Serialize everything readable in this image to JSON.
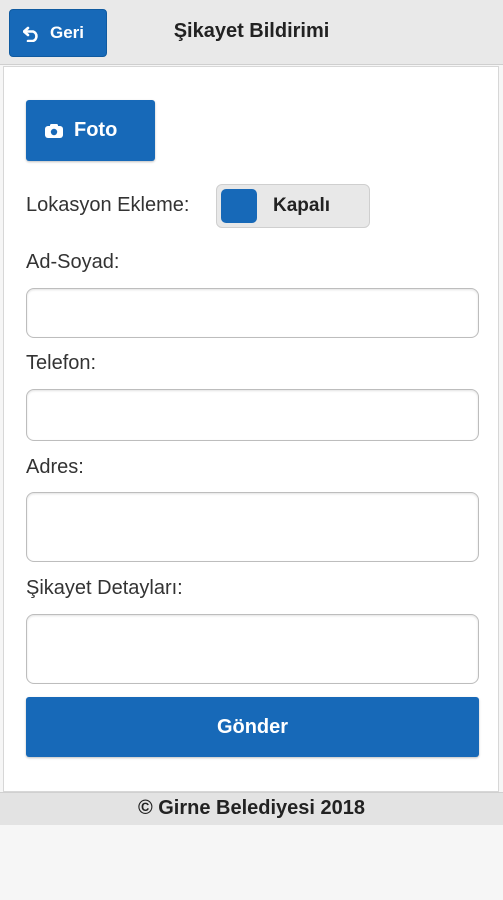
{
  "header": {
    "back_label": "Geri",
    "title": "Şikayet Bildirimi",
    "back_icon": "undo-arrow-icon"
  },
  "form": {
    "photo_label": "Foto",
    "photo_icon": "camera-icon",
    "location_label": "Lokasyon Ekleme:",
    "location_toggle_state": "Kapalı",
    "fields": [
      {
        "label": "Ad-Soyad:",
        "value": ""
      },
      {
        "label": "Telefon:",
        "value": ""
      },
      {
        "label": "Adres:",
        "value": ""
      },
      {
        "label": "Şikayet Detayları:",
        "value": ""
      }
    ],
    "submit_label": "Gönder"
  },
  "footer": {
    "copyright": "© Girne Belediyesi 2018"
  },
  "colors": {
    "accent": "#1769b8",
    "header_bg": "#e9e9e9"
  }
}
